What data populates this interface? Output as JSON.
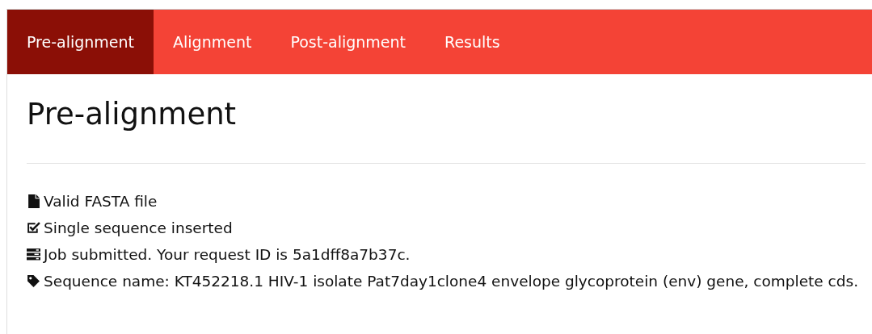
{
  "tabs": [
    {
      "label": "Pre-alignment",
      "selected": true
    },
    {
      "label": "Alignment",
      "selected": false
    },
    {
      "label": "Post-alignment",
      "selected": false
    },
    {
      "label": "Results",
      "selected": false
    }
  ],
  "heading": "Pre-alignment",
  "items": [
    {
      "kind": "file",
      "text": "Valid FASTA file"
    },
    {
      "kind": "check",
      "text": "Single sequence inserted"
    },
    {
      "kind": "server",
      "text": "Job submitted. Your request ID is 5a1dff8a7b37c."
    },
    {
      "kind": "tag",
      "text": "Sequence name: KT452218.1 HIV-1 isolate Pat7day1clone4 envelope glycoprotein (env) gene, complete cds."
    }
  ]
}
